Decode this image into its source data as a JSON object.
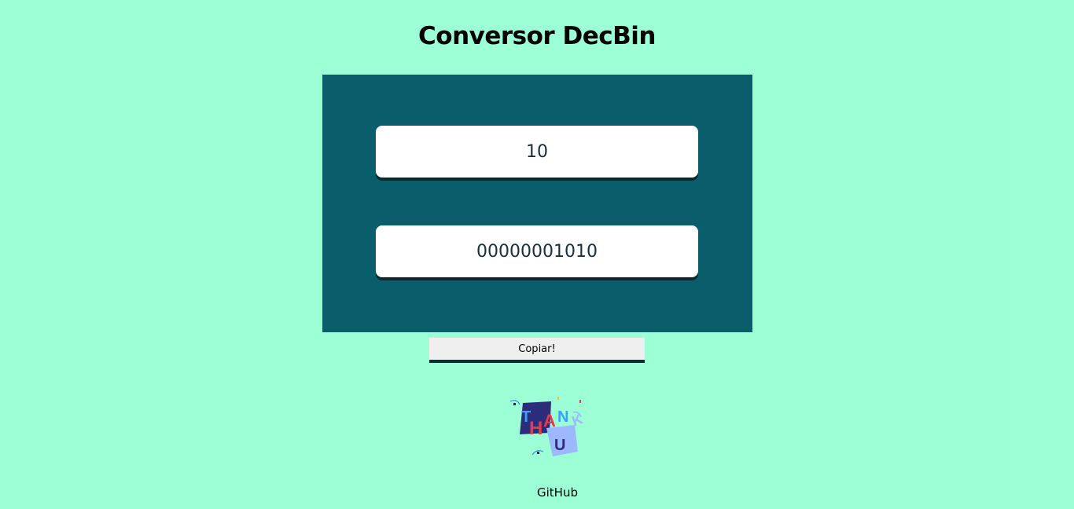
{
  "page": {
    "title": "Conversor DecBin",
    "background_color": "#9cffd5"
  },
  "converter": {
    "panel_color": "#0a5d6a",
    "decimal_value": "10",
    "binary_value": "00000001010"
  },
  "actions": {
    "copy_label": "Copiar!"
  },
  "illustration": {
    "icon": "thank-you-sticker",
    "letters": [
      "T",
      "H",
      "A",
      "N",
      "K",
      "U"
    ]
  },
  "footer": {
    "github_label": "GitHub"
  }
}
